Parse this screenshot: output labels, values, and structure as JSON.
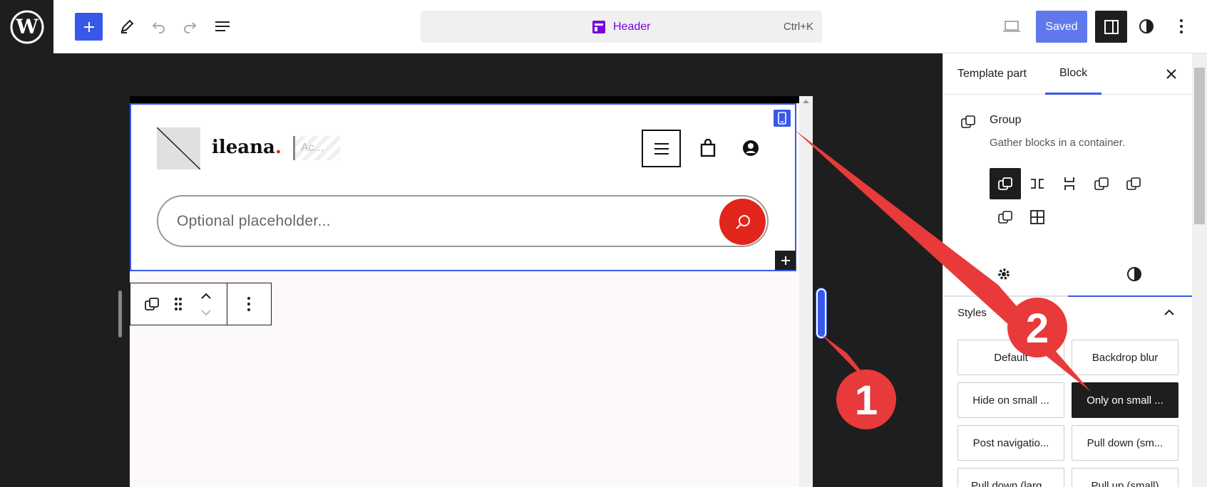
{
  "topbar": {
    "document_title": "Header",
    "shortcut": "Ctrl+K",
    "saved_label": "Saved",
    "icons": [
      "wordpress-logo",
      "plus-icon",
      "pencil-icon",
      "undo-icon",
      "redo-icon",
      "list-view-icon",
      "template-part-icon",
      "desktop-icon",
      "sidebar-toggle-icon",
      "styles-icon",
      "more-icon"
    ]
  },
  "canvas": {
    "site_title": "ileana",
    "site_title_dot": ".",
    "tagline": "Ac...",
    "search_placeholder": "Optional placeholder...",
    "icons": [
      "menu-icon",
      "bag-icon",
      "account-icon",
      "search-icon",
      "mobile-device-icon",
      "plus-icon",
      "group-icon",
      "drag-icon",
      "chevron-up-icon",
      "chevron-down-icon",
      "more-vertical-icon"
    ]
  },
  "sidebar": {
    "tabs": [
      {
        "label": "Template part",
        "active": false
      },
      {
        "label": "Block",
        "active": true
      }
    ],
    "block_name": "Group",
    "block_description": "Gather blocks in a container.",
    "styles_label": "Styles",
    "style_options": [
      {
        "label": "Default",
        "active": false
      },
      {
        "label": "Backdrop blur",
        "active": false
      },
      {
        "label": "Hide on small ...",
        "active": false
      },
      {
        "label": "Only on small ...",
        "active": true
      },
      {
        "label": "Post navigatio...",
        "active": false
      },
      {
        "label": "Pull down (sm...",
        "active": false
      },
      {
        "label": "Pull down (larg...",
        "active": false
      },
      {
        "label": "Pull up (small)",
        "active": false
      }
    ]
  },
  "annotations": {
    "marker_1": "1",
    "marker_2": "2",
    "color": "#e83a3a"
  },
  "colors": {
    "accent": "#3858e9",
    "search_button": "#e1251b",
    "template_part": "#7a00df"
  }
}
